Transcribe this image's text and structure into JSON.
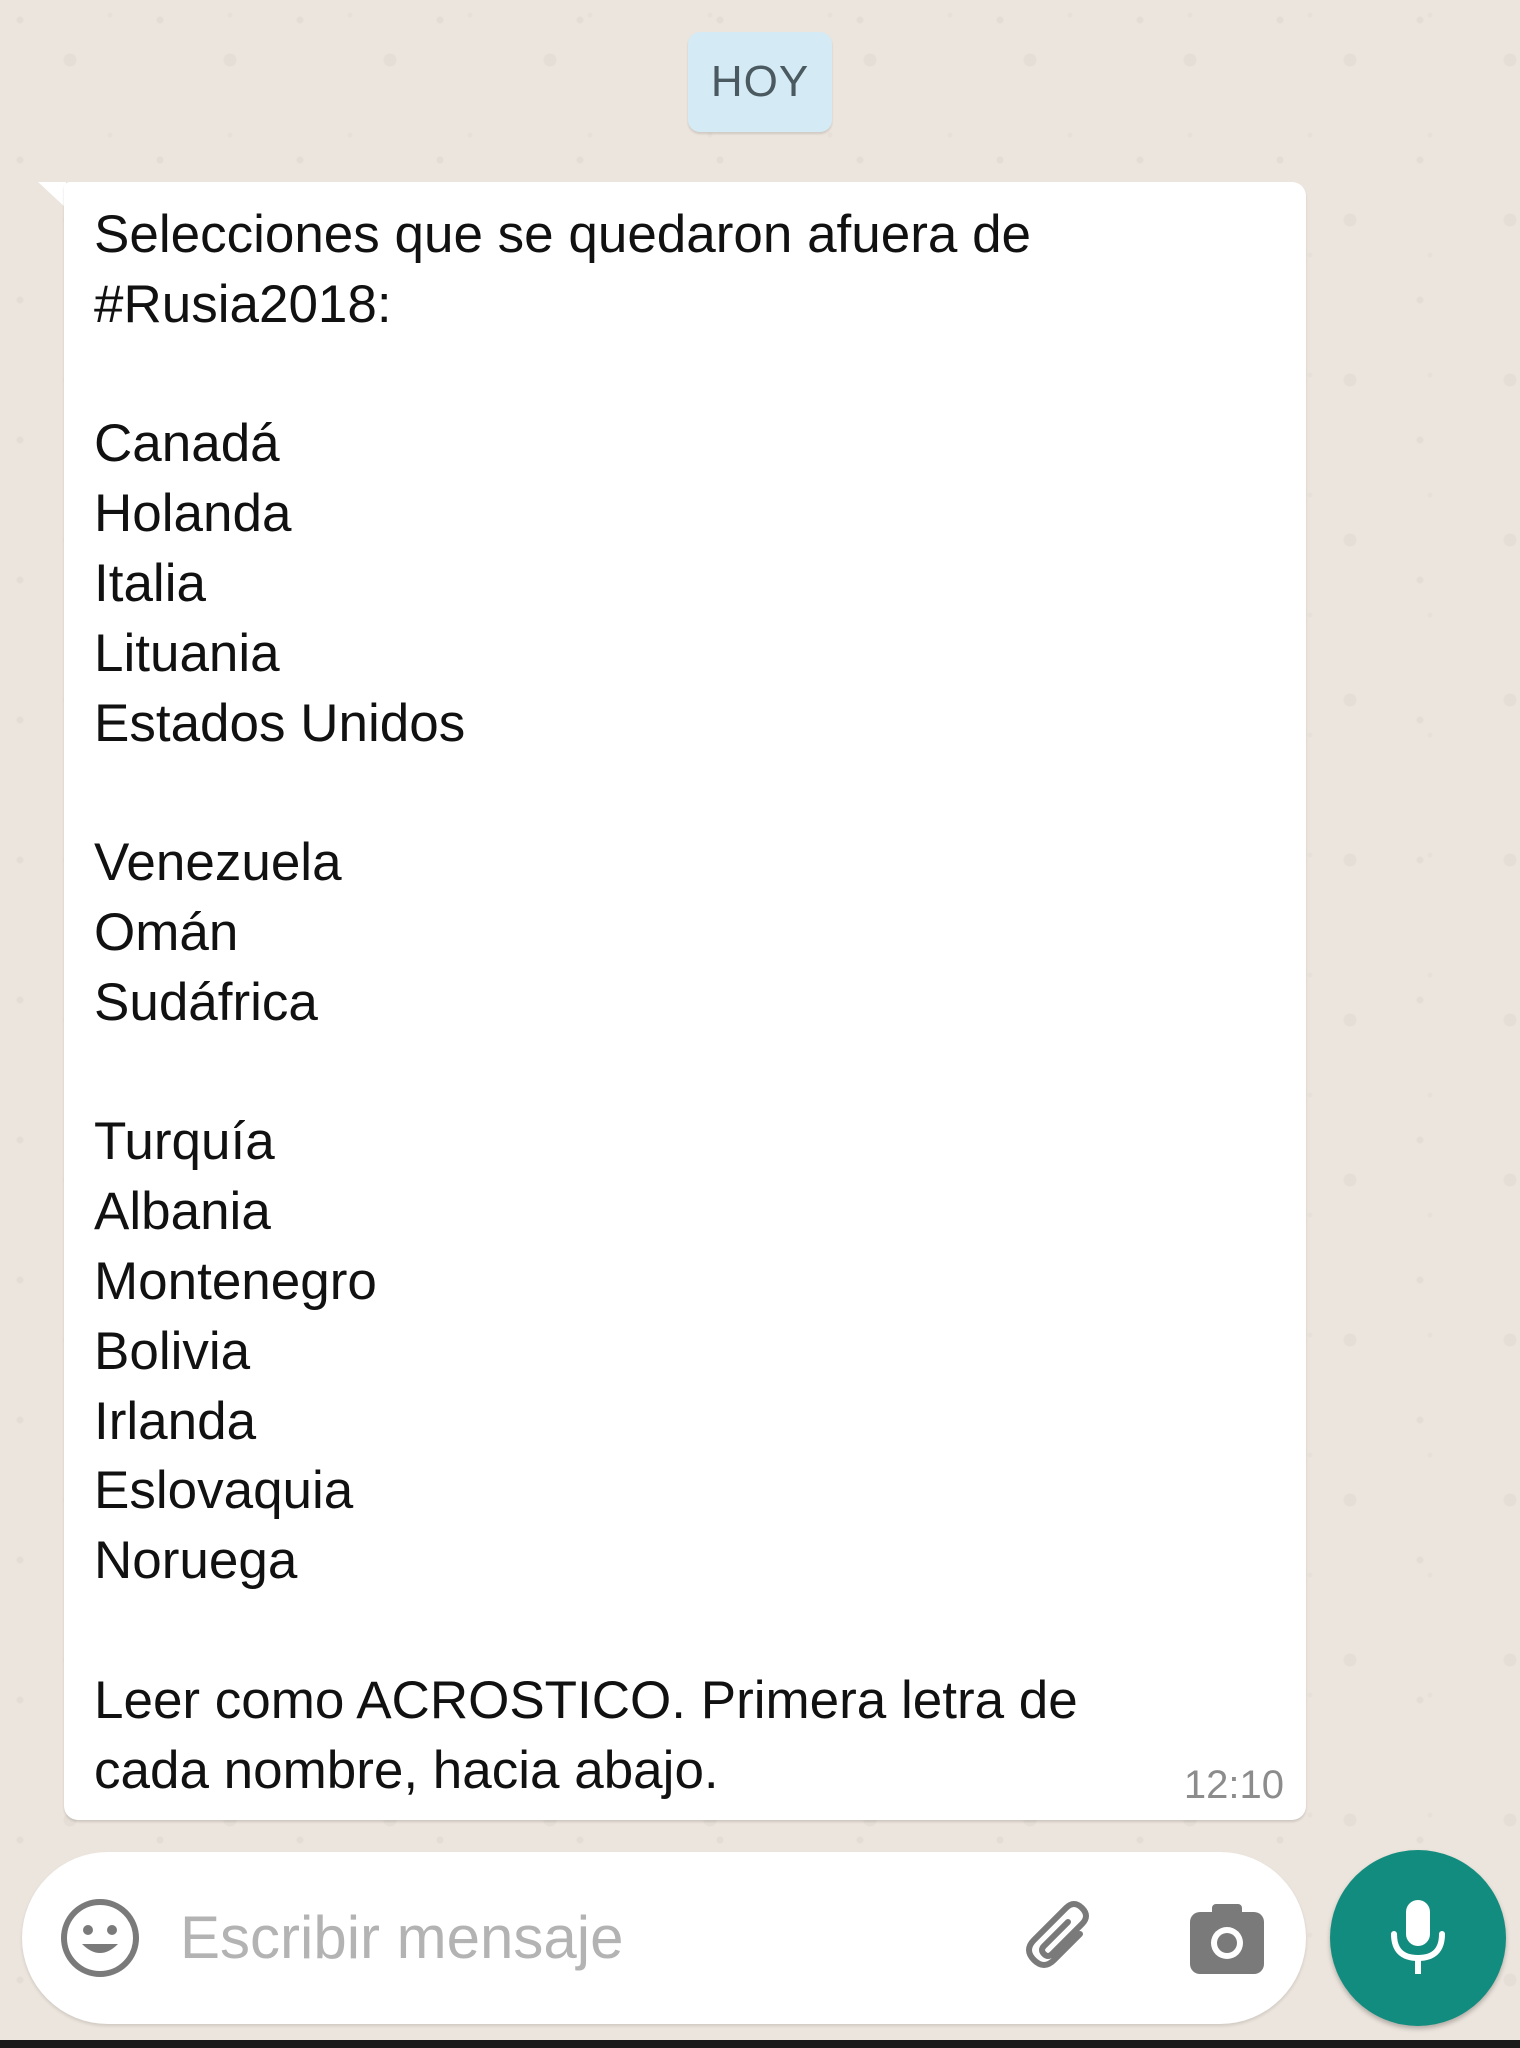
{
  "chat": {
    "date_label": "HOY",
    "message": {
      "text": "Selecciones que se quedaron afuera de\n#Rusia2018:\n\nCanadá\nHolanda\nItalia\nLituania\nEstados Unidos\n\nVenezuela\nOmán\nSudáfrica\n\nTurquía\nAlbania\nMontenegro\nBolivia\nIrlanda\nEslovaquia\nNoruega\n\nLeer como ACROSTICO. Primera letra de\ncada nombre, hacia abajo.",
      "time": "12:10"
    }
  },
  "composer": {
    "placeholder": "Escribir mensaje",
    "icons": {
      "emoji": "emoji-icon",
      "attach": "paperclip-icon",
      "camera": "camera-icon",
      "mic": "microphone-icon"
    }
  },
  "colors": {
    "chat_background": "#ece5dd",
    "bubble": "#ffffff",
    "date_chip": "#d4eaf4",
    "mic_button": "#128c7e"
  }
}
